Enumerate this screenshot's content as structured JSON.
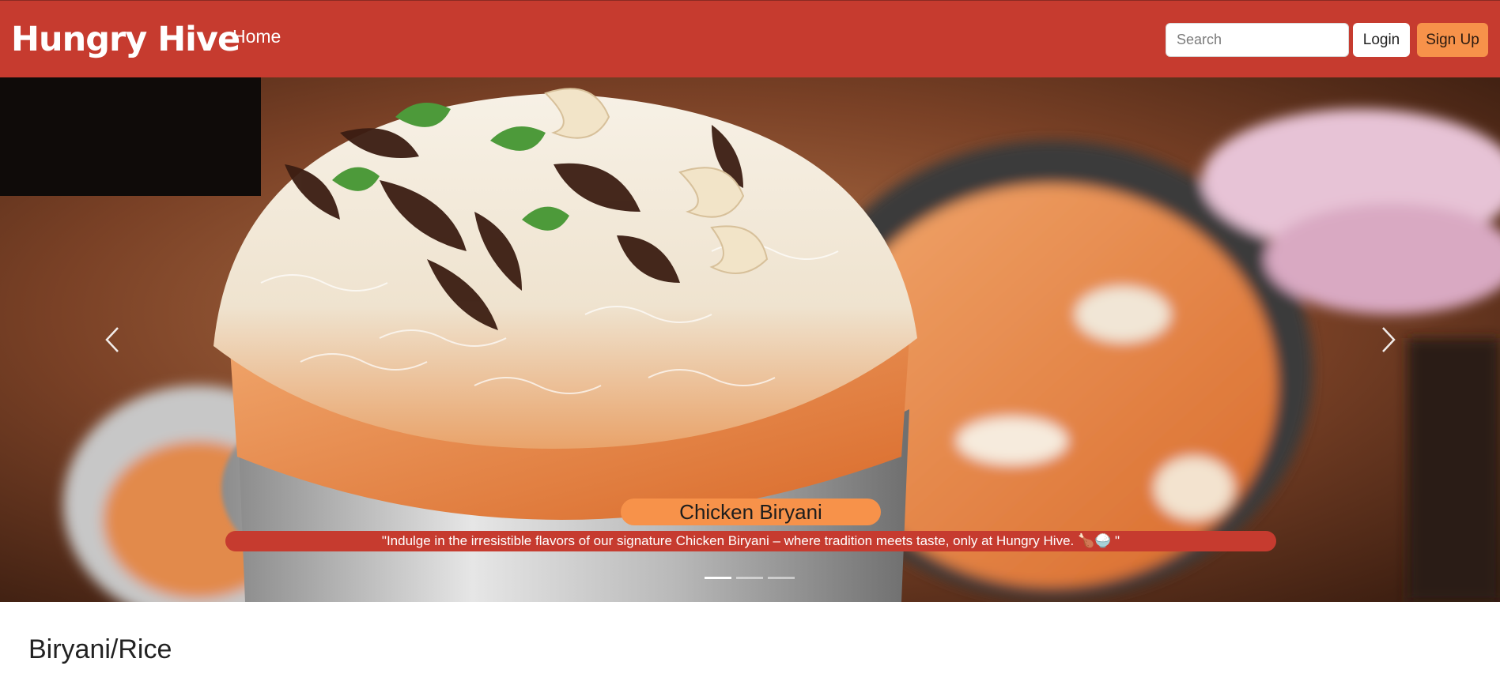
{
  "navbar": {
    "brand": "Hungry Hive",
    "home_label": "Home",
    "search_placeholder": "Search",
    "login_label": "Login",
    "signup_label": "Sign Up"
  },
  "carousel": {
    "image_subject": "chicken biryani in a silver pot topped with fried onions, cashews and cilantro",
    "slide_count": 3,
    "active_slide_index": 0,
    "caption_title": "Chicken Biryani",
    "caption_text": "\"Indulge in the irresistible flavors of our signature Chicken Biryani – where tradition meets taste, only at Hungry Hive. 🍗🍚 \"",
    "prev_icon": "chevron-left-icon",
    "next_icon": "chevron-right-icon"
  },
  "section": {
    "title": "Biryani/Rice"
  },
  "colors": {
    "navbar": "#c63b2f",
    "accent": "#f7924a",
    "white": "#ffffff"
  }
}
